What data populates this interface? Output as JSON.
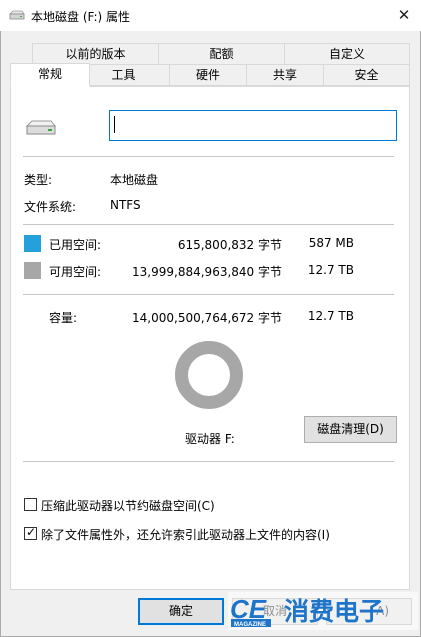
{
  "window": {
    "title": "本地磁盘 (F:) 属性",
    "close_glyph": "✕",
    "drive_icon": "drive-icon"
  },
  "tabs_row1": [
    "以前的版本",
    "配额",
    "自定义"
  ],
  "tabs_row2": [
    "常规",
    "工具",
    "硬件",
    "共享",
    "安全"
  ],
  "active_tab": "常规",
  "general": {
    "name_value": "",
    "type_label": "类型:",
    "type_value": "本地磁盘",
    "fs_label": "文件系统:",
    "fs_value": "NTFS"
  },
  "space": {
    "used": {
      "label": "已用空间:",
      "bytes": "615,800,832 字节",
      "size": "587 MB",
      "color": "#26a0da"
    },
    "free": {
      "label": "可用空间:",
      "bytes": "13,999,884,963,840 字节",
      "size": "12.7 TB",
      "color": "#a7a7a7"
    },
    "capacity": {
      "label": "容量:",
      "bytes": "14,000,500,764,672 字节",
      "size": "12.7 TB"
    },
    "used_fraction": 4.4e-05
  },
  "drive_label": "驱动器 F:",
  "cleanup_button": "磁盘清理(D)",
  "checkboxes": [
    {
      "label": "压缩此驱动器以节约磁盘空间(C)",
      "checked": false,
      "mark": ""
    },
    {
      "label": "除了文件属性外，还允许索引此驱动器上文件的内容(I)",
      "checked": true,
      "mark": "✓"
    }
  ],
  "buttons": {
    "ok": "确定",
    "cancel": "取消",
    "apply": "A)"
  },
  "watermark": {
    "brand": "CE",
    "sub": "MAGAZINE",
    "text": "消费电子",
    "color": "#1e74c8"
  }
}
